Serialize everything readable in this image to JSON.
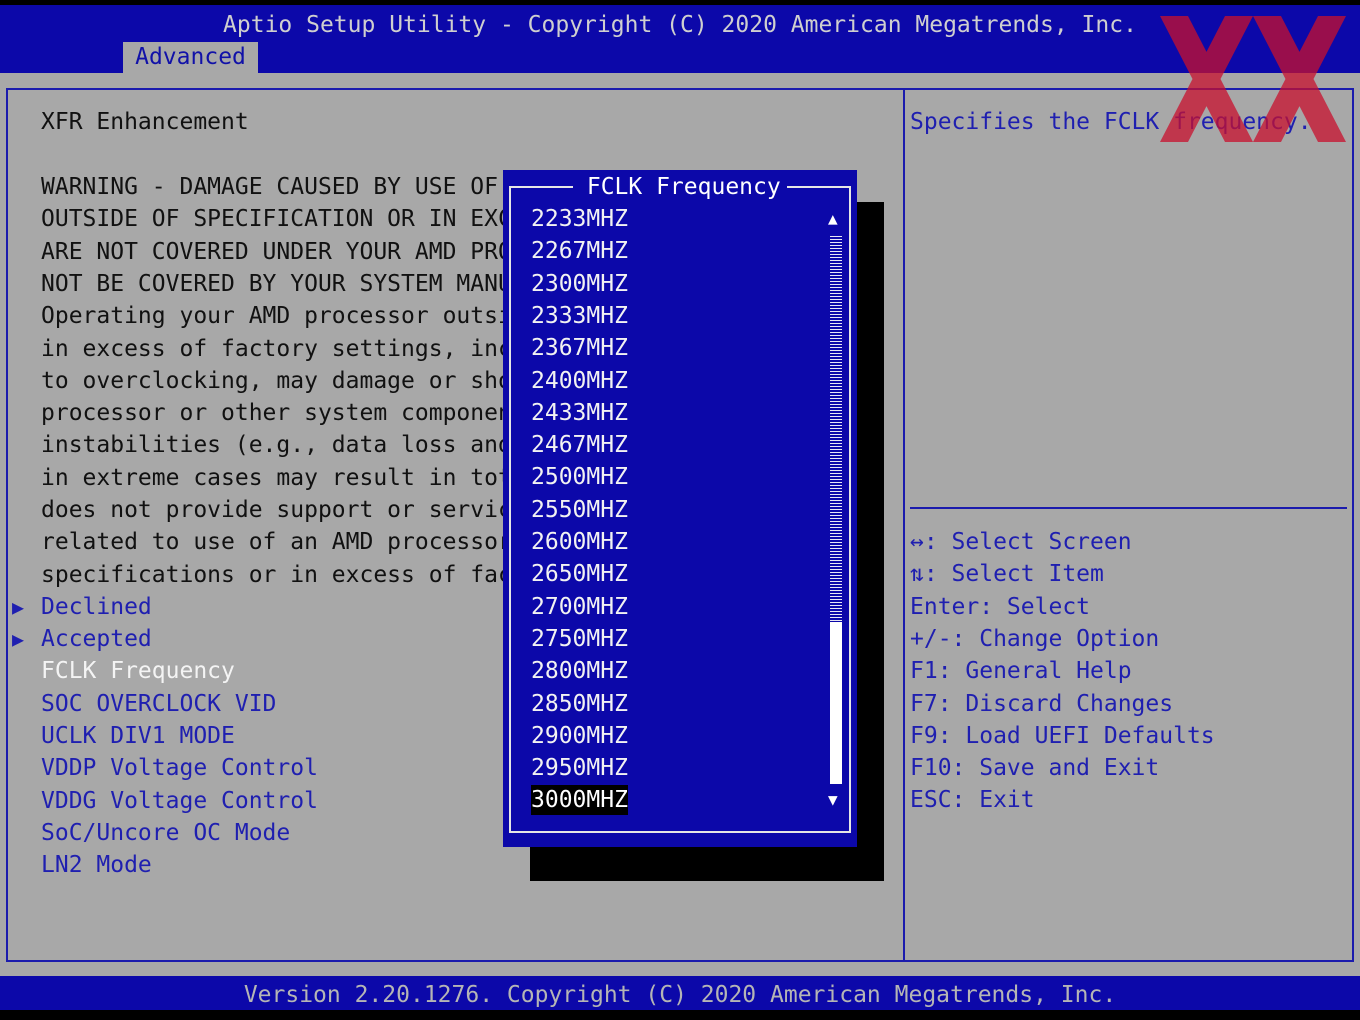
{
  "header": {
    "title": "Aptio Setup Utility - Copyright (C) 2020 American Megatrends, Inc.",
    "active_tab": "Advanced"
  },
  "left_panel": {
    "heading": "XFR Enhancement",
    "warning_lines": [
      "WARNING - DAMAGE CAUSED BY USE OF",
      "OUTSIDE OF SPECIFICATION OR IN EXC",
      "ARE NOT COVERED UNDER YOUR AMD PRO",
      "NOT BE COVERED BY YOUR SYSTEM MANU",
      "Operating your AMD processor outsi",
      "in excess of factory settings, inc",
      "to overclocking, may damage or sho",
      "processor or other system componen",
      "instabilities (e.g., data loss and",
      "in extreme cases may result in tot",
      "does not provide support or servic",
      "related to use of an AMD processor",
      "specifications or in excess of fac"
    ],
    "submenu_items": [
      "Declined",
      "Accepted"
    ],
    "submenu_arrow": "▶",
    "items": [
      "FCLK Frequency",
      "SOC OVERCLOCK VID",
      "UCLK DIV1 MODE",
      "VDDP Voltage Control",
      "VDDG Voltage Control",
      "SoC/Uncore OC Mode",
      "LN2 Mode"
    ]
  },
  "popup": {
    "title": " FCLK Frequency ",
    "options": [
      "2233MHZ",
      "2267MHZ",
      "2300MHZ",
      "2333MHZ",
      "2367MHZ",
      "2400MHZ",
      "2433MHZ",
      "2467MHZ",
      "2500MHZ",
      "2550MHZ",
      "2600MHZ",
      "2650MHZ",
      "2700MHZ",
      "2750MHZ",
      "2800MHZ",
      "2850MHZ",
      "2900MHZ",
      "2950MHZ",
      "3000MHZ"
    ],
    "selected": "3000MHZ",
    "scroll_up": "▲",
    "scroll_down": "▼"
  },
  "right_panel": {
    "help_text": "Specifies the FCLK frequency.",
    "key_help": [
      "↔: Select Screen",
      "⇅: Select Item",
      "Enter: Select",
      "+/-: Change Option",
      "F1: General Help",
      "F7: Discard Changes",
      "F9: Load UEFI Defaults",
      "F10: Save and Exit",
      "ESC: Exit"
    ]
  },
  "footer": {
    "version": "Version 2.20.1276. Copyright (C) 2020 American Megatrends, Inc."
  },
  "colors": {
    "bar_blue": "#0c08a9",
    "panel_gray": "#a8a8a8",
    "link_blue": "#1f1fb0",
    "logo_red": "#c8102e"
  }
}
